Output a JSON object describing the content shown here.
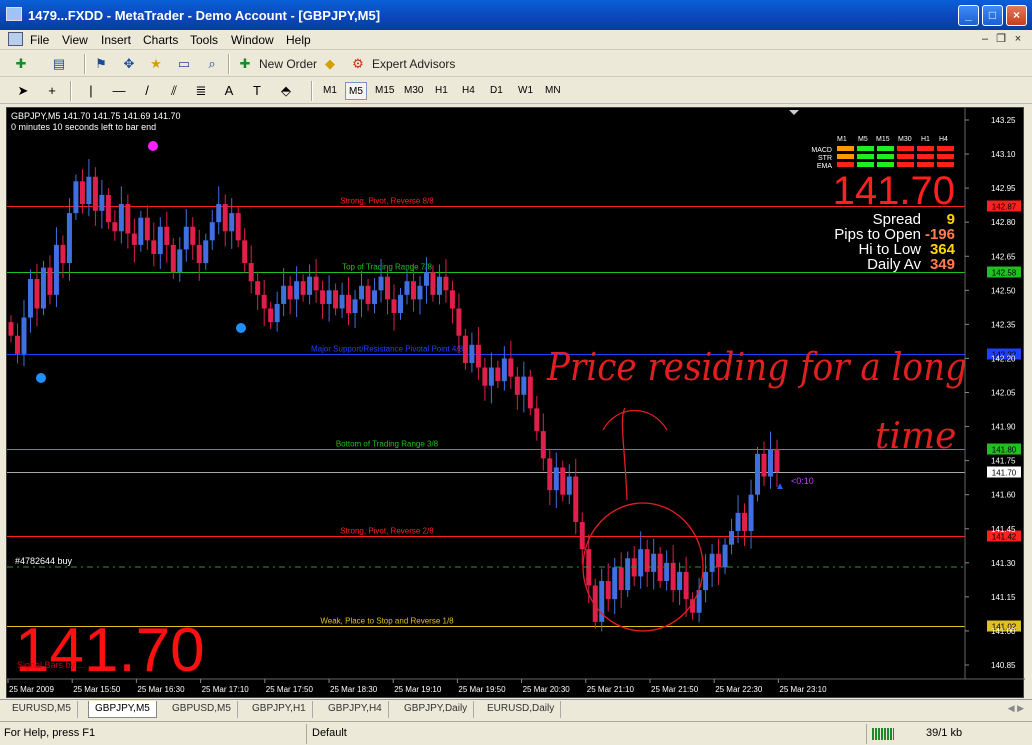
{
  "window": {
    "title": "1479...FXDD - MetaTrader - Demo Account - [GBPJPY,M5]"
  },
  "menu": [
    "File",
    "View",
    "Insert",
    "Charts",
    "Tools",
    "Window",
    "Help"
  ],
  "toolbar": {
    "new_order": "New Order",
    "expert_advisors": "Expert Advisors",
    "text_tool": "A",
    "timeframes": [
      "M1",
      "M5",
      "M15",
      "M30",
      "H1",
      "H4",
      "D1",
      "W1",
      "MN"
    ],
    "active_timeframe": "M5"
  },
  "chart": {
    "header_line1": "GBPJPY,M5  141.70 141.75 141.69 141.70",
    "header_line2": "0 minutes 10 seconds left to bar end",
    "big_price": "141.70",
    "big_price_bottom": "141.70",
    "signal_text": "Signal Bars by ...",
    "countdown": "<0:10",
    "order_label": "#4782644 buy",
    "annotation_line1": "Price residing for a long",
    "annotation_line2": "time",
    "grid_labels": {
      "timeframes": [
        "M1",
        "M5",
        "M15",
        "M30",
        "H1",
        "H4"
      ],
      "rows": [
        "MACD",
        "STR",
        "EMA"
      ]
    },
    "stats": [
      {
        "label": "Spread",
        "value": "9",
        "color": "#ffd700"
      },
      {
        "label": "Pips to Open",
        "value": "-196",
        "color": "#ff7f50"
      },
      {
        "label": "Hi to Low",
        "value": "364",
        "color": "#ffd700"
      },
      {
        "label": "Daily Av",
        "value": "349",
        "color": "#ff7f50"
      }
    ],
    "levels": [
      {
        "price": 142.87,
        "label": "Strong, Pivot, Reverse  8/8",
        "color": "#ff2020",
        "tag": "142.87"
      },
      {
        "price": 142.58,
        "label": "Top of Trading Range  7/8",
        "color": "#20c020",
        "tag": "142.58"
      },
      {
        "price": 142.22,
        "label": "Major Support/Resistance Pivotal Point  4/8",
        "color": "#2040ff",
        "tag": "142.22"
      },
      {
        "price": 141.8,
        "label": "Bottom of Trading Range  3/8",
        "color": "#20c020",
        "tag": "141.80"
      },
      {
        "price": 141.42,
        "label": "Strong, Pivot, Reverse  2/8",
        "color": "#ff2020",
        "tag": "141.42"
      },
      {
        "price": 141.02,
        "label": "Weak, Place to Stop and Reverse  1/8",
        "color": "#e0c020",
        "tag": "141.02"
      }
    ],
    "price_axis": [
      "143.25",
      "143.10",
      "142.95",
      "142.80",
      "142.65",
      "142.50",
      "142.35",
      "142.20",
      "142.05",
      "141.90",
      "141.75",
      "141.60",
      "141.45",
      "141.30",
      "141.15",
      "141.00",
      "140.85"
    ],
    "current_price_tag": "141.70",
    "time_axis": [
      "25 Mar 2009",
      "25 Mar 15:50",
      "25 Mar 16:30",
      "25 Mar 17:10",
      "25 Mar 17:50",
      "25 Mar 18:30",
      "25 Mar 19:10",
      "25 Mar 19:50",
      "25 Mar 20:30",
      "25 Mar 21:10",
      "25 Mar 21:50",
      "25 Mar 22:30",
      "25 Mar 23:10"
    ],
    "colors": {
      "bull": "#4070e0",
      "bear": "#e0204a",
      "doji": "#c8e890",
      "bg": "#000000",
      "axis_text": "#ffffff"
    }
  },
  "tabs": [
    "EURUSD,M5",
    "GBPJPY,M5",
    "GBPUSD,M5",
    "GBPJPY,H1",
    "GBPJPY,H4",
    "GBPJPY,Daily",
    "EURUSD,Daily"
  ],
  "active_tab": "GBPJPY,M5",
  "status": {
    "help": "For Help, press F1",
    "profile": "Default",
    "traffic": "39/1 kb"
  }
}
